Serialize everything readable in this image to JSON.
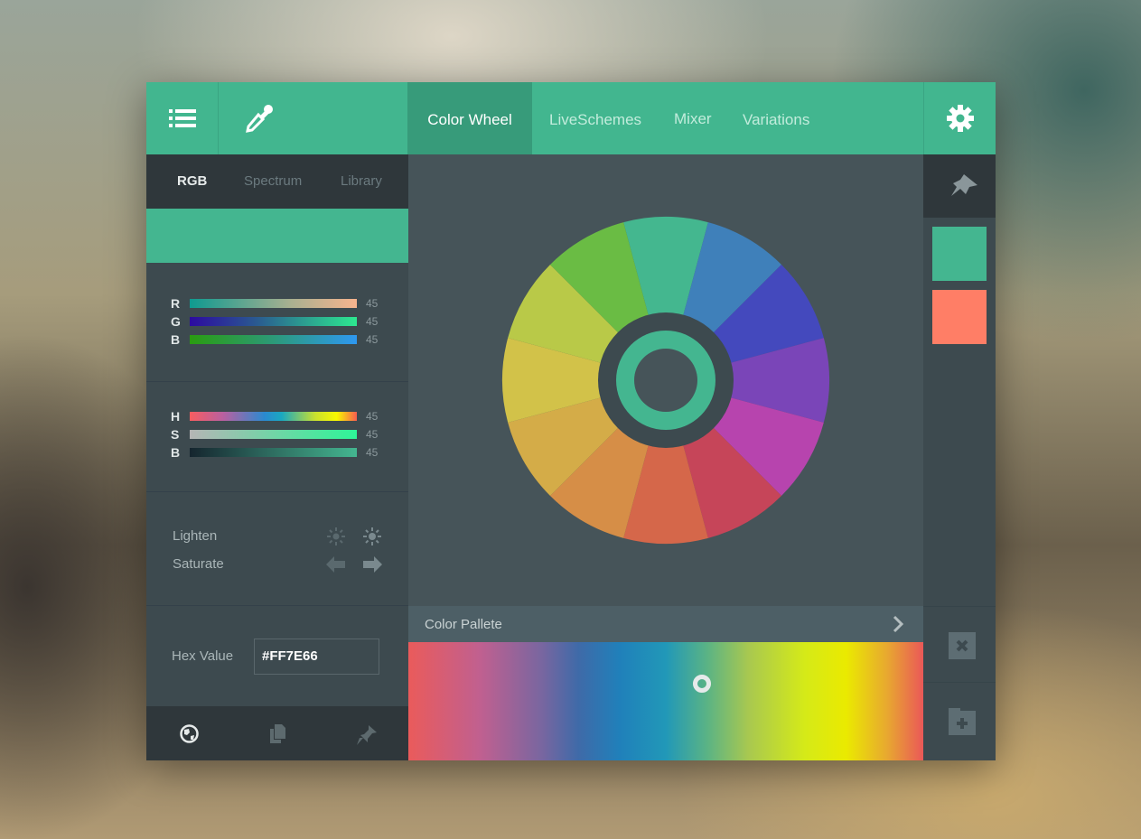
{
  "header": {
    "tabs": [
      {
        "label": "Color Wheel",
        "active": true
      },
      {
        "label": "LiveSchemes"
      },
      {
        "label": "Mixer"
      },
      {
        "label": "Variations"
      }
    ],
    "menu_icon": "list-icon",
    "picker_icon": "eyedropper-icon",
    "settings_icon": "gear-icon"
  },
  "left": {
    "subtabs": [
      {
        "label": "RGB",
        "active": true
      },
      {
        "label": "Spectrum"
      },
      {
        "label": "Library"
      }
    ],
    "current_color": "#44B690",
    "rgb": [
      {
        "label": "R",
        "value": "45"
      },
      {
        "label": "G",
        "value": "45"
      },
      {
        "label": "B",
        "value": "45"
      }
    ],
    "hsb": [
      {
        "label": "H",
        "value": "45"
      },
      {
        "label": "S",
        "value": "45"
      },
      {
        "label": "B",
        "value": "45"
      }
    ],
    "adjust": {
      "lighten": "Lighten",
      "saturate": "Saturate"
    },
    "hex": {
      "label": "Hex Value",
      "value": "#FF7E66"
    },
    "footer_icons": [
      "globe-icon",
      "copy-icon",
      "pin-icon"
    ]
  },
  "wheel": {
    "segments": [
      "#44B78F",
      "#3F80BA",
      "#4449BD",
      "#7A45B8",
      "#B744AE",
      "#C64559",
      "#D5674A",
      "#D68E47",
      "#D4AC48",
      "#D2C249",
      "#B9C948",
      "#6ABC44"
    ],
    "selected": "#44B690"
  },
  "palette": {
    "title": "Color Pallete",
    "marker_position_pct": 57
  },
  "saved": {
    "colors": [
      "#44B690",
      "#FF7E66"
    ]
  }
}
